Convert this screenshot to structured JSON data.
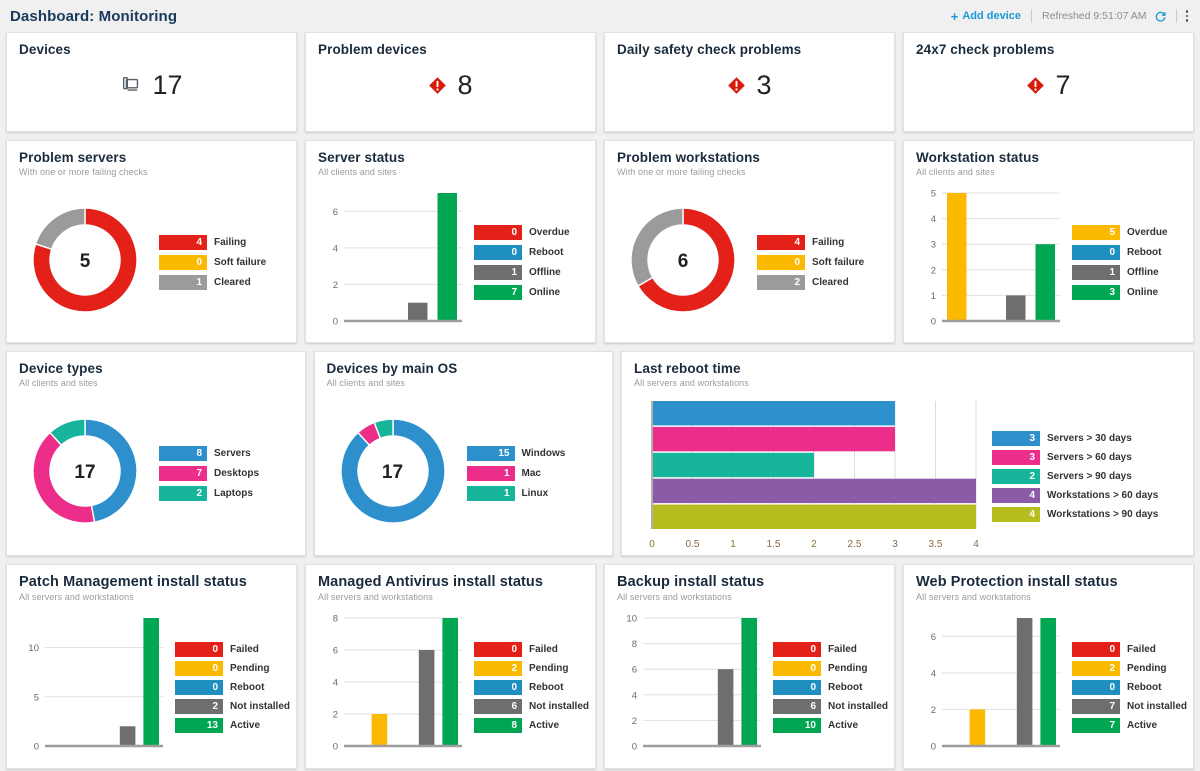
{
  "header": {
    "title": "Dashboard: Monitoring",
    "add_device_label": "Add device",
    "add_device_plus": "+",
    "refreshed_label": "Refreshed 9:51:07 AM",
    "refresh_icon": "refresh-icon",
    "menu_icon": "kebab-menu-icon"
  },
  "colors": {
    "red": "#E32119",
    "red_alt": "#E0281E",
    "yellow": "#FBBA00",
    "gray": "#6E6E6E",
    "green": "#00A651",
    "blue": "#2D8FCC",
    "pink": "#EC2E8A",
    "teal": "#17B59B",
    "purple": "#8B5BA8",
    "olive": "#B5BD1F",
    "accent": "#1A9AD6",
    "title": "#1A3A5C"
  },
  "kpis": [
    {
      "title": "Devices",
      "value": "17",
      "icon": "devices-icon",
      "icon_type": "devices"
    },
    {
      "title": "Problem devices",
      "value": "8",
      "icon": "alert-diamond-icon",
      "icon_type": "alert"
    },
    {
      "title": "Daily safety check problems",
      "value": "3",
      "icon": "alert-diamond-icon",
      "icon_type": "alert"
    },
    {
      "title": "24x7 check problems",
      "value": "7",
      "icon": "alert-diamond-icon",
      "icon_type": "alert"
    }
  ],
  "cards": {
    "problem_servers": {
      "title": "Problem servers",
      "subtitle": "With one or more failing checks",
      "center": "5"
    },
    "server_status": {
      "title": "Server status",
      "subtitle": "All clients and sites"
    },
    "problem_workstations": {
      "title": "Problem workstations",
      "subtitle": "With one or more failing checks",
      "center": "6"
    },
    "workstation_status": {
      "title": "Workstation status",
      "subtitle": "All clients and sites"
    },
    "device_types": {
      "title": "Device types",
      "subtitle": "All clients and sites",
      "center": "17"
    },
    "devices_os": {
      "title": "Devices by main OS",
      "subtitle": "All clients and sites",
      "center": "17"
    },
    "last_reboot": {
      "title": "Last reboot time",
      "subtitle": "All servers and workstations"
    },
    "patch": {
      "title": "Patch Management install status",
      "subtitle": "All servers and workstations"
    },
    "antivirus": {
      "title": "Managed Antivirus install status",
      "subtitle": "All servers and workstations"
    },
    "backup": {
      "title": "Backup install status",
      "subtitle": "All servers and workstations"
    },
    "webprotect": {
      "title": "Web Protection install status",
      "subtitle": "All servers and workstations"
    }
  },
  "chart_data": [
    {
      "id": "problem_servers",
      "type": "pie",
      "title": "Problem servers",
      "subtitle": "With one or more failing checks",
      "center_total": 5,
      "legend_position": "right",
      "labels": [
        "Failing",
        "Soft failure",
        "Cleared"
      ],
      "values": [
        4,
        0,
        1
      ],
      "colors": [
        "#E32119",
        "#FBBA00",
        "#9B9B9B"
      ]
    },
    {
      "id": "server_status",
      "type": "bar",
      "title": "Server status",
      "subtitle": "All clients and sites",
      "categories": [
        "Overdue",
        "Reboot",
        "Offline",
        "Online"
      ],
      "values": [
        0,
        0,
        1,
        7
      ],
      "colors": [
        "#E32119",
        "#1F8FC0",
        "#6E6E6E",
        "#00A651"
      ],
      "yticks": [
        0,
        2,
        4,
        6
      ],
      "ylim": [
        0,
        7
      ],
      "grid": true,
      "legend_position": "right"
    },
    {
      "id": "problem_workstations",
      "type": "pie",
      "title": "Problem workstations",
      "subtitle": "With one or more failing checks",
      "center_total": 6,
      "legend_position": "right",
      "labels": [
        "Failing",
        "Soft failure",
        "Cleared"
      ],
      "values": [
        4,
        0,
        2
      ],
      "colors": [
        "#E32119",
        "#FBBA00",
        "#9B9B9B"
      ]
    },
    {
      "id": "workstation_status",
      "type": "bar",
      "title": "Workstation status",
      "subtitle": "All clients and sites",
      "categories": [
        "Overdue",
        "Reboot",
        "Offline",
        "Online"
      ],
      "values": [
        5,
        0,
        1,
        3
      ],
      "colors": [
        "#FBBA00",
        "#1F8FC0",
        "#6E6E6E",
        "#00A651"
      ],
      "yticks": [
        0,
        1,
        2,
        3,
        4,
        5
      ],
      "ylim": [
        0,
        5
      ],
      "grid": true,
      "legend_position": "right"
    },
    {
      "id": "device_types",
      "type": "pie",
      "title": "Device types",
      "subtitle": "All clients and sites",
      "center_total": 17,
      "legend_position": "right",
      "labels": [
        "Servers",
        "Desktops",
        "Laptops"
      ],
      "values": [
        8,
        7,
        2
      ],
      "colors": [
        "#2D8FCC",
        "#EC2E8A",
        "#17B59B"
      ]
    },
    {
      "id": "devices_os",
      "type": "pie",
      "title": "Devices by main OS",
      "subtitle": "All clients and sites",
      "center_total": 17,
      "legend_position": "right",
      "labels": [
        "Windows",
        "Mac",
        "Linux"
      ],
      "values": [
        15,
        1,
        1
      ],
      "colors": [
        "#2D8FCC",
        "#EC2E8A",
        "#17B59B"
      ]
    },
    {
      "id": "last_reboot",
      "type": "bar",
      "orientation": "horizontal",
      "title": "Last reboot time",
      "subtitle": "All servers and workstations",
      "categories": [
        "Servers > 30 days",
        "Servers > 60 days",
        "Servers > 90 days",
        "Workstations > 60 days",
        "Workstations > 90 days"
      ],
      "values": [
        3,
        3,
        2,
        4,
        4
      ],
      "colors": [
        "#2D8FCC",
        "#EC2E8A",
        "#17B59B",
        "#8B5BA8",
        "#B5BD1F"
      ],
      "xticks": [
        "0",
        "0.5",
        "1",
        "1.5",
        "2",
        "2.5",
        "3",
        "3.5",
        "4"
      ],
      "xlim": [
        0,
        4
      ],
      "grid": true,
      "legend_position": "right"
    },
    {
      "id": "patch",
      "type": "bar",
      "title": "Patch Management install status",
      "subtitle": "All servers and workstations",
      "categories": [
        "Failed",
        "Pending",
        "Reboot",
        "Not installed",
        "Active"
      ],
      "values": [
        0,
        0,
        0,
        2,
        13
      ],
      "colors": [
        "#E32119",
        "#FBBA00",
        "#1F8FC0",
        "#6E6E6E",
        "#00A651"
      ],
      "yticks": [
        0,
        5,
        10
      ],
      "ylim": [
        0,
        13
      ],
      "grid": true,
      "legend_position": "right"
    },
    {
      "id": "antivirus",
      "type": "bar",
      "title": "Managed Antivirus install status",
      "subtitle": "All servers and workstations",
      "categories": [
        "Failed",
        "Pending",
        "Reboot",
        "Not installed",
        "Active"
      ],
      "values": [
        0,
        2,
        0,
        6,
        8
      ],
      "colors": [
        "#E32119",
        "#FBBA00",
        "#1F8FC0",
        "#6E6E6E",
        "#00A651"
      ],
      "yticks": [
        0,
        2,
        4,
        6,
        8
      ],
      "ylim": [
        0,
        8
      ],
      "grid": true,
      "legend_position": "right"
    },
    {
      "id": "backup",
      "type": "bar",
      "title": "Backup install status",
      "subtitle": "All servers and workstations",
      "categories": [
        "Failed",
        "Pending",
        "Reboot",
        "Not installed",
        "Active"
      ],
      "values": [
        0,
        0,
        0,
        6,
        10
      ],
      "colors": [
        "#E32119",
        "#FBBA00",
        "#1F8FC0",
        "#6E6E6E",
        "#00A651"
      ],
      "yticks": [
        0,
        2,
        4,
        6,
        8,
        10
      ],
      "ylim": [
        0,
        10
      ],
      "grid": true,
      "legend_position": "right"
    },
    {
      "id": "webprotect",
      "type": "bar",
      "title": "Web Protection install status",
      "subtitle": "All servers and workstations",
      "categories": [
        "Failed",
        "Pending",
        "Reboot",
        "Not installed",
        "Active"
      ],
      "values": [
        0,
        2,
        0,
        7,
        7
      ],
      "colors": [
        "#E32119",
        "#FBBA00",
        "#1F8FC0",
        "#6E6E6E",
        "#00A651"
      ],
      "yticks": [
        0,
        2,
        4,
        6
      ],
      "ylim": [
        0,
        7
      ],
      "grid": true,
      "legend_position": "right"
    }
  ]
}
